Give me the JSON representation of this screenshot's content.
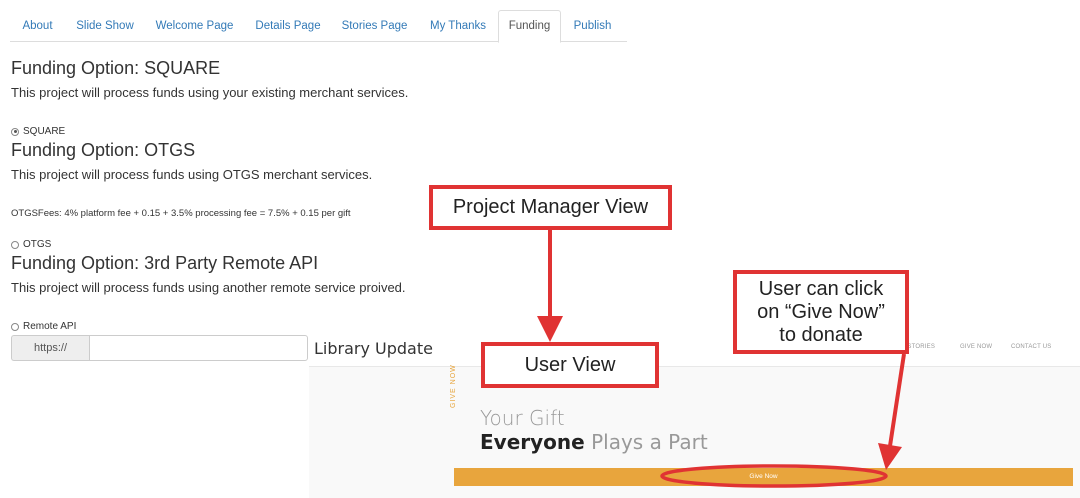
{
  "tabs": [
    {
      "label": "About"
    },
    {
      "label": "Slide Show"
    },
    {
      "label": "Welcome Page"
    },
    {
      "label": "Details Page"
    },
    {
      "label": "Stories Page"
    },
    {
      "label": "My Thanks"
    },
    {
      "label": "Funding",
      "active": true
    },
    {
      "label": "Publish"
    }
  ],
  "funding": {
    "square": {
      "heading": "Funding Option: SQUARE",
      "desc": "This project will process funds using your existing merchant services.",
      "radio_label": "SQUARE",
      "checked": true
    },
    "otgs": {
      "heading": "Funding Option: OTGS",
      "desc": "This project will process funds using OTGS merchant services.",
      "fees": "OTGSFees: 4% platform fee + 0.15 + 3.5% processing fee = 7.5% + 0.15 per gift",
      "radio_label": "OTGS",
      "checked": false
    },
    "remote": {
      "heading": "Funding Option: 3rd Party Remote API",
      "desc": "This project will process funds using another remote service proived.",
      "radio_label": "Remote API",
      "checked": false,
      "url_prefix": "https://",
      "url_value": ""
    }
  },
  "user_view": {
    "site_title": "Library Update",
    "nav": [
      "R STORIES",
      "GIVE NOW",
      "CONTACT US"
    ],
    "give_now_vertical": "GIVE NOW",
    "headline_line1": "Your Gift",
    "headline_bold": "Everyone",
    "headline_rest": " Plays a Part",
    "give_button": "Give Now"
  },
  "annotations": {
    "pm_view": "Project Manager View",
    "user_view": "User View",
    "user_click": [
      "User can click",
      "on “Give Now”",
      "to donate"
    ],
    "accent": "#e03333"
  }
}
